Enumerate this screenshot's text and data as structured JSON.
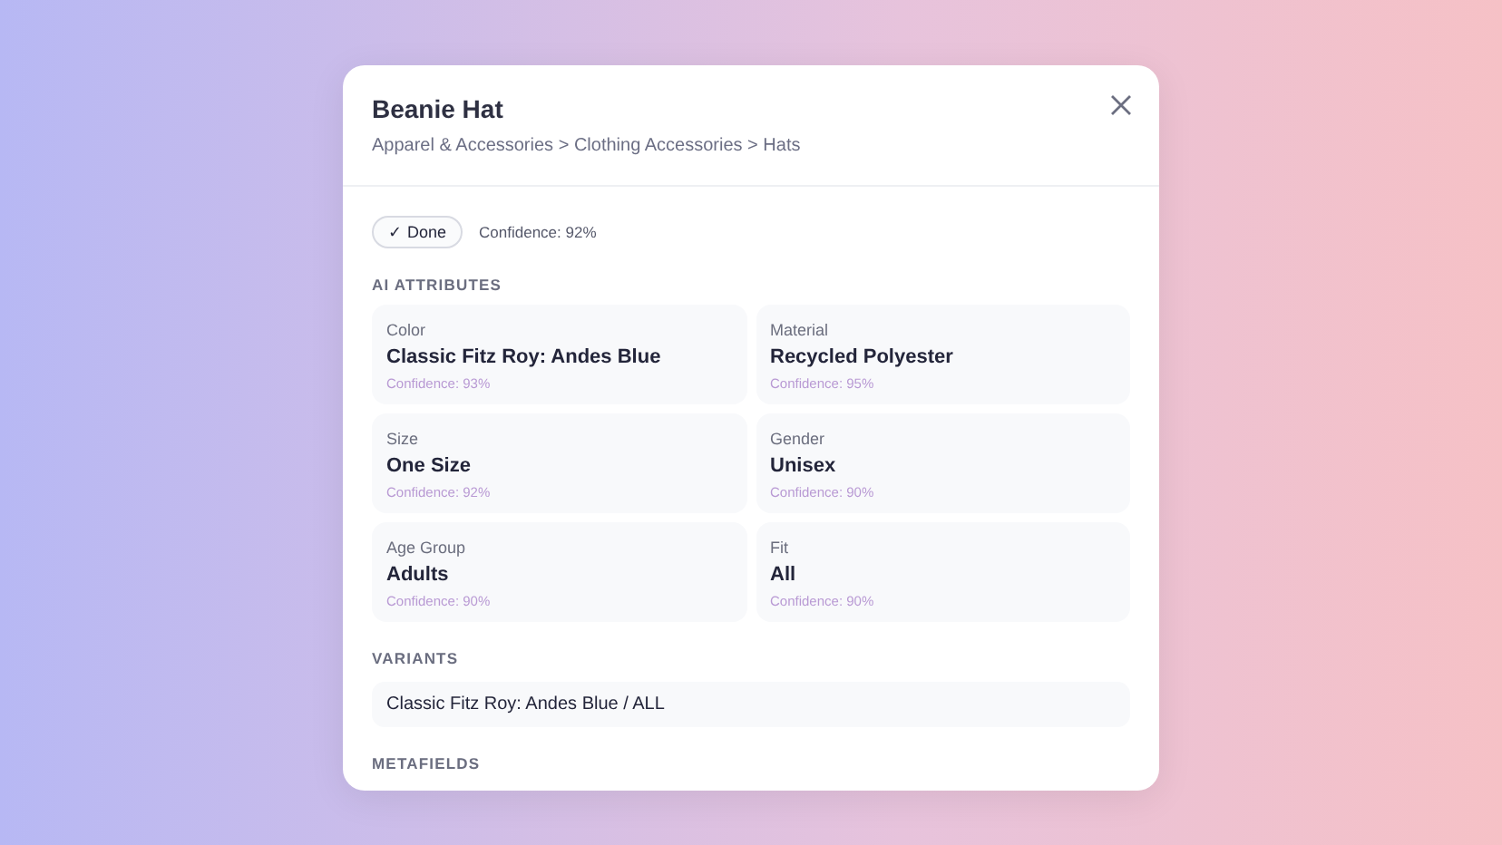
{
  "title": "Beanie Hat",
  "breadcrumb": "Apparel & Accessories > Clothing Accessories > Hats",
  "status": {
    "label": "✓ Done",
    "confidence": "Confidence: 92%"
  },
  "ai_attributes": {
    "heading": "AI ATTRIBUTES",
    "items": [
      {
        "label": "Color",
        "value": "Classic Fitz Roy: Andes Blue",
        "confidence": "Confidence: 93%"
      },
      {
        "label": "Material",
        "value": "Recycled Polyester",
        "confidence": "Confidence: 95%"
      },
      {
        "label": "Size",
        "value": "One Size",
        "confidence": "Confidence: 92%"
      },
      {
        "label": "Gender",
        "value": "Unisex",
        "confidence": "Confidence: 90%"
      },
      {
        "label": "Age Group",
        "value": "Adults",
        "confidence": "Confidence: 90%"
      },
      {
        "label": "Fit",
        "value": "All",
        "confidence": "Confidence: 90%"
      }
    ]
  },
  "variants": {
    "heading": "VARIANTS",
    "items": [
      "Classic Fitz Roy: Andes Blue / ALL"
    ]
  },
  "metafields": {
    "heading": "METAFIELDS"
  }
}
